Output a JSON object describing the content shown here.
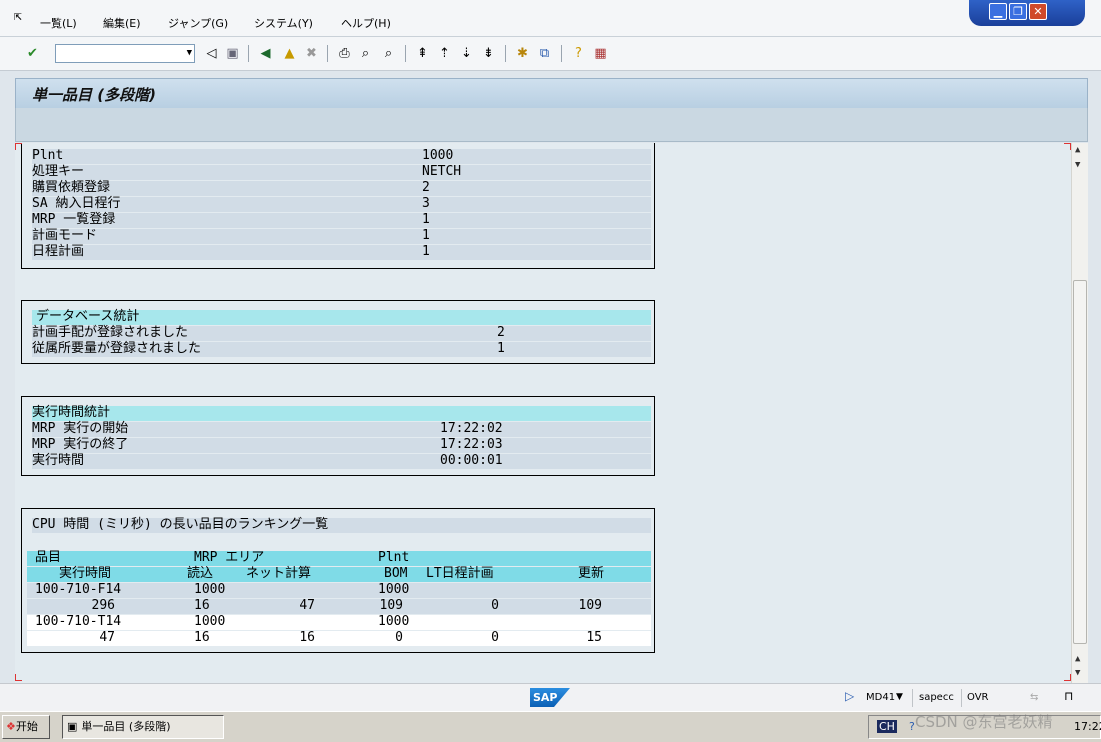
{
  "menu": {
    "items": [
      "一覧(L)",
      "編集(E)",
      "ジャンプ(G)",
      "システム(Y)",
      "ヘルプ(H)"
    ]
  },
  "window_buttons": {
    "minimize": "▁",
    "restore": "❐",
    "close": "✕"
  },
  "toolbar": {
    "command_field_value": "",
    "icons": [
      "enter-icon",
      "back-arrow-icon",
      "save-icon",
      "back-icon",
      "exit-icon",
      "cancel-icon",
      "print-icon",
      "find-icon",
      "find-next-icon",
      "first-page-icon",
      "previous-page-icon",
      "next-page-icon",
      "last-page-icon",
      "create-session-icon",
      "shortcut-icon",
      "help-icon",
      "layout-icon"
    ]
  },
  "title": {
    "text": "単一品目 (多段階)"
  },
  "section_params": {
    "rows": [
      {
        "label": "Plnt",
        "value": "1000"
      },
      {
        "label": "処理キー",
        "value": "NETCH"
      },
      {
        "label": "購買依頼登録",
        "value": "2"
      },
      {
        "label": "SA 納入日程行",
        "value": "3"
      },
      {
        "label": "MRP 一覧登録",
        "value": "1"
      },
      {
        "label": "計画モード",
        "value": "1"
      },
      {
        "label": "日程計画",
        "value": "1"
      }
    ]
  },
  "section_db": {
    "title": "データベース統計",
    "rows": [
      {
        "label": "計画手配が登録されました",
        "value": "2"
      },
      {
        "label": "従属所要量が登録されました",
        "value": "1"
      }
    ]
  },
  "section_time": {
    "title": "実行時間統計",
    "rows": [
      {
        "label": "MRP 実行の開始",
        "value": "17:22:02"
      },
      {
        "label": "MRP 実行の終了",
        "value": "17:22:03"
      },
      {
        "label": "実行時間",
        "value": "00:00:01"
      }
    ]
  },
  "section_cpu": {
    "title": "CPU 時間 (ミリ秒) の長い品目のランキング一覧",
    "header1": {
      "material": "品目",
      "mrp_area": "MRP エリア",
      "plant": "Plnt"
    },
    "header2": {
      "runtime": "実行時間",
      "read": "読込",
      "net": "ネット計算",
      "bom": "BOM",
      "lt": "LT日程計画",
      "update": "更新"
    },
    "items": [
      {
        "material": "100-710-F14",
        "mrp_area": "1000",
        "plant": "1000",
        "runtime": "296",
        "read": "16",
        "net": "47",
        "bom": "109",
        "lt": "0",
        "update": "109"
      },
      {
        "material": "100-710-T14",
        "mrp_area": "1000",
        "plant": "1000",
        "runtime": "47",
        "read": "16",
        "net": "16",
        "bom": "0",
        "lt": "0",
        "update": "15"
      }
    ]
  },
  "statusbar": {
    "sap_logo": "SAP",
    "transaction": "MD41",
    "system": "sapecc",
    "mode": "OVR"
  },
  "taskbar": {
    "start": "开始",
    "task": "単一品目 (多段階)",
    "lang": "CH",
    "clock": "17:22"
  },
  "watermark": "CSDN @东宫老妖精"
}
